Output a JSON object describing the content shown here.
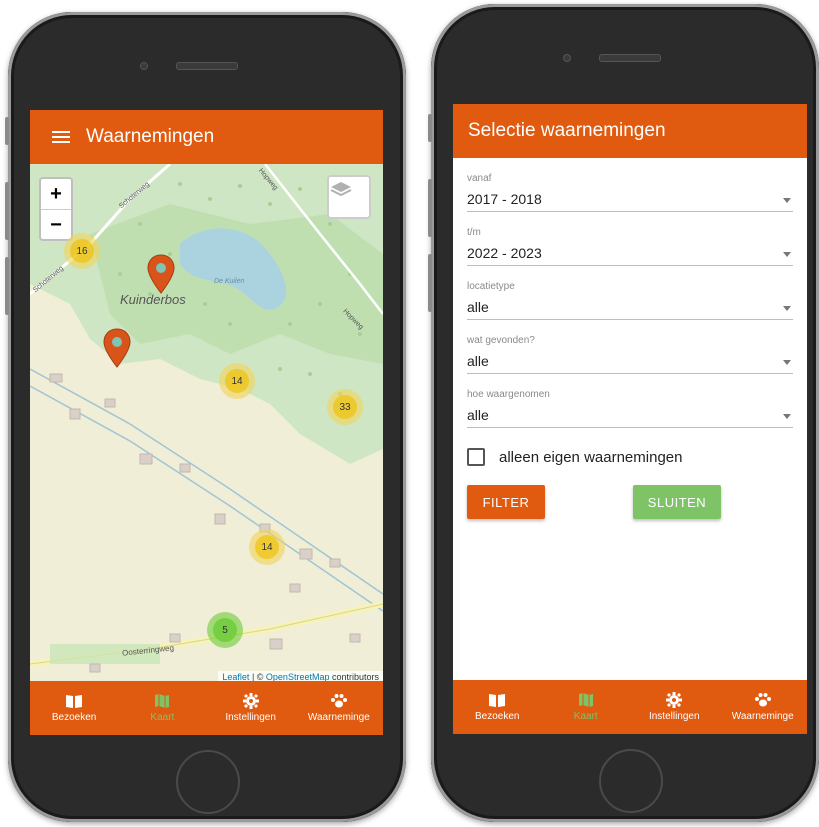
{
  "left_screen": {
    "title": "Waarnemingen",
    "zoom_in": "+",
    "zoom_out": "−",
    "map_labels": {
      "area": "Kuinderbos",
      "lake": "De Kuilen",
      "road_oosterringweg": "Oosterringweg",
      "road_schoterweg_top": "Schoterweg",
      "road_schoterweg_left": "Schoterweg",
      "road_hopweg_top": "Hopweg",
      "road_hopweg_right": "Hopweg"
    },
    "clusters": [
      {
        "count": "16",
        "color": "yellow"
      },
      {
        "count": "14",
        "color": "yellow"
      },
      {
        "count": "33",
        "color": "yellow"
      },
      {
        "count": "14",
        "color": "yellow"
      },
      {
        "count": "5",
        "color": "green"
      }
    ],
    "attribution": {
      "leaflet": "Leaflet",
      "separator": " | © ",
      "osm": "OpenStreetMap",
      "contributors": " contributors"
    }
  },
  "right_screen": {
    "title": "Selectie waarnemingen",
    "fields": [
      {
        "label": "vanaf",
        "value": "2017 - 2018"
      },
      {
        "label": "t/m",
        "value": "2022 - 2023"
      },
      {
        "label": "locatietype",
        "value": "alle"
      },
      {
        "label": "wat gevonden?",
        "value": "alle"
      },
      {
        "label": "hoe waargenomen",
        "value": "alle"
      }
    ],
    "checkbox_label": "alleen eigen waarnemingen",
    "filter_button": "FILTER",
    "close_button": "SLUITEN"
  },
  "nav": [
    {
      "label": "Bezoeken",
      "icon": "book-icon"
    },
    {
      "label": "Kaart",
      "icon": "map-icon"
    },
    {
      "label": "Instellingen",
      "icon": "gear-icon"
    },
    {
      "label": "Waarneminge",
      "icon": "paw-icon"
    }
  ],
  "colors": {
    "primary": "#e05a0f",
    "accent_green": "#7ec467",
    "cluster_yellow": "#f0c20c",
    "marker": "#d9541a"
  }
}
